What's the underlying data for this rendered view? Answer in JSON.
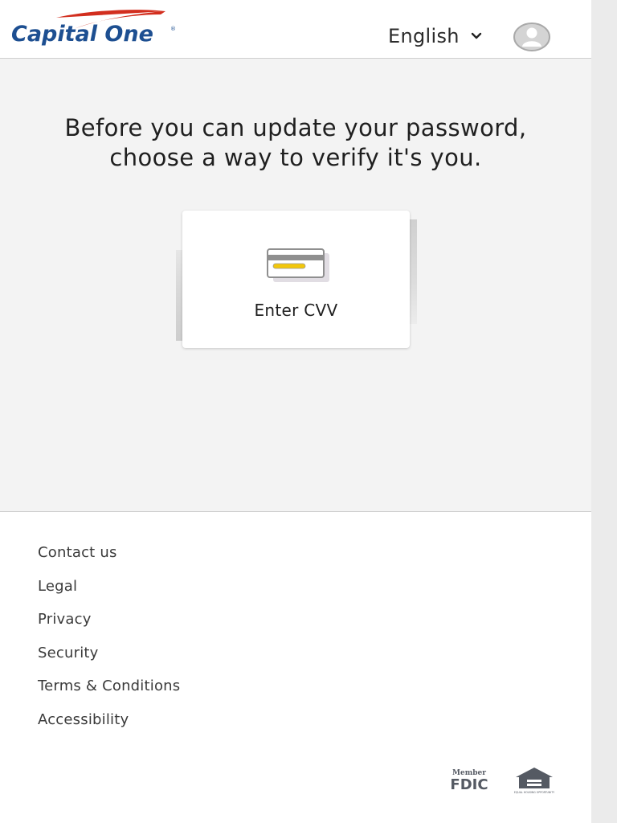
{
  "header": {
    "logo_text": "Capital One",
    "language_label": "English",
    "icons": {
      "language_toggle": "chevron-down-icon",
      "account": "user-avatar-icon"
    }
  },
  "main": {
    "heading_line1": "Before you can update your password,",
    "heading_line2": "choose a way to verify it's you.",
    "options": [
      {
        "label": "Enter CVV",
        "icon": "credit-card-icon"
      }
    ]
  },
  "footer": {
    "links": [
      "Contact us",
      "Legal",
      "Privacy",
      "Security",
      "Terms & Conditions",
      "Accessibility"
    ],
    "badges": {
      "fdic_top": "Member",
      "fdic_bottom": "FDIC",
      "ehl_text": "EQUAL HOUSING OPPORTUNITY"
    }
  },
  "colors": {
    "brand_blue": "#1d4f91",
    "brand_red": "#d22e1e",
    "card_stripe_yellow": "#f2c70a",
    "background_gray": "#f3f3f3"
  }
}
